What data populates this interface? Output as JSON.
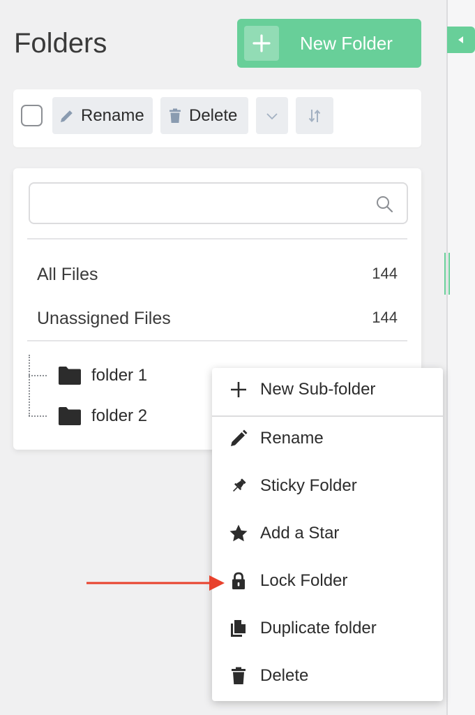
{
  "header": {
    "title": "Folders",
    "new_folder_label": "New Folder"
  },
  "toolbar": {
    "rename_label": "Rename",
    "delete_label": "Delete"
  },
  "search": {
    "placeholder": ""
  },
  "filters": [
    {
      "label": "All Files",
      "count": "144"
    },
    {
      "label": "Unassigned Files",
      "count": "144"
    }
  ],
  "folders": [
    {
      "name": "folder 1"
    },
    {
      "name": "folder 2"
    }
  ],
  "context_menu": {
    "items": [
      {
        "label": "New Sub-folder",
        "icon": "plus-icon"
      },
      {
        "label": "Rename",
        "icon": "pencil-icon"
      },
      {
        "label": "Sticky Folder",
        "icon": "pin-icon"
      },
      {
        "label": "Add a Star",
        "icon": "star-icon"
      },
      {
        "label": "Lock Folder",
        "icon": "lock-icon"
      },
      {
        "label": "Duplicate folder",
        "icon": "duplicate-icon"
      },
      {
        "label": "Delete",
        "icon": "trash-icon"
      }
    ]
  },
  "colors": {
    "accent": "#68cf99",
    "annotation_arrow": "#e8412c"
  }
}
